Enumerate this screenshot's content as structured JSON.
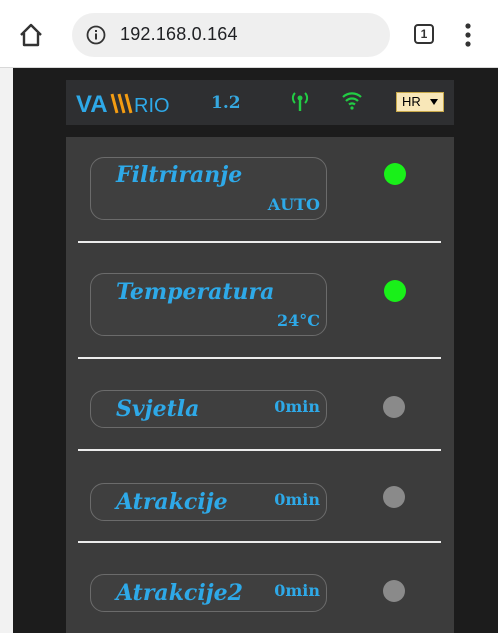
{
  "browser": {
    "url": "192.168.0.164",
    "tab_count": "1"
  },
  "header": {
    "logo_text": "VA\\\\\\RIO",
    "version": "1.2",
    "language": "HR",
    "antenna_color": "#22cc44",
    "wifi_color": "#22cc44"
  },
  "colors": {
    "active_dot": "#19f019",
    "inactive_dot": "#8a8a8a",
    "label": "#2ea9e8"
  },
  "items": [
    {
      "name": "Filtriranje",
      "value": "AUTO",
      "status": "active"
    },
    {
      "name": "Temperatura",
      "value": "24°C",
      "status": "active"
    },
    {
      "name": "Svjetla",
      "value": "0min",
      "status": "inactive"
    },
    {
      "name": "Atrakcije",
      "value": "0min",
      "status": "inactive"
    },
    {
      "name": "Atrakcije2",
      "value": "0min",
      "status": "inactive"
    }
  ]
}
